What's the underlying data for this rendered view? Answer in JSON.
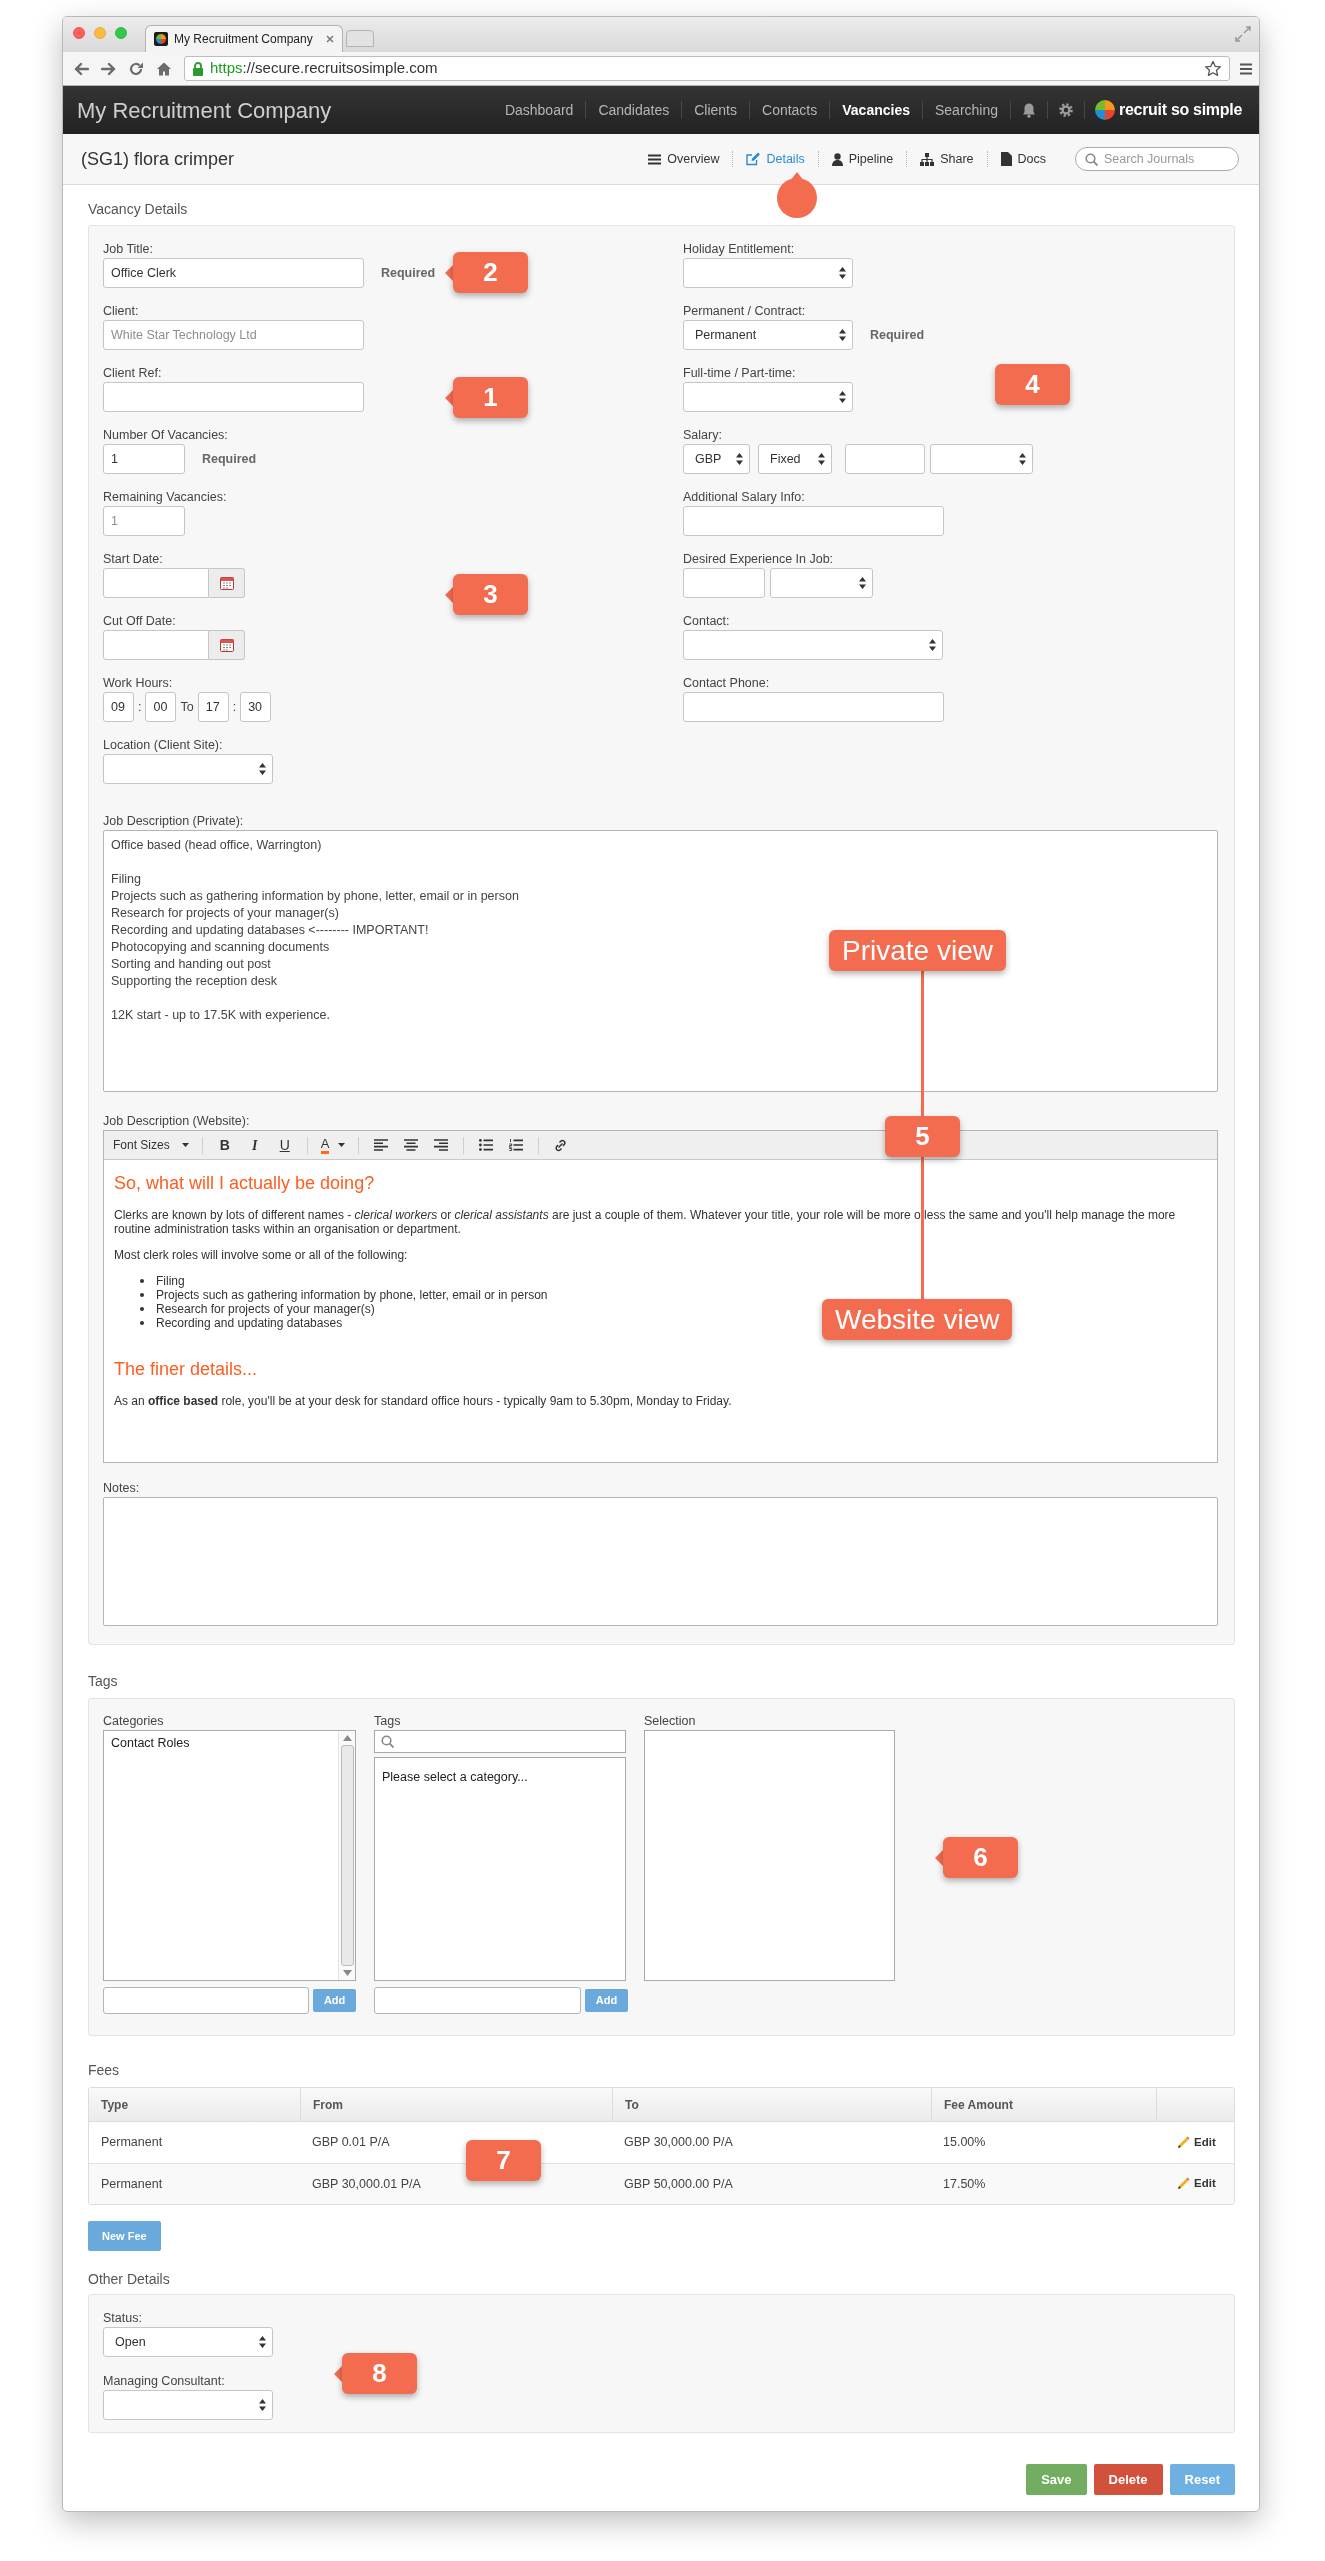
{
  "browser": {
    "tab_title": "My Recruitment Company",
    "url_scheme": "https",
    "url_rest": "://secure.recruitsosimple.com"
  },
  "navbar": {
    "brand": "My Recruitment Company",
    "items": [
      {
        "label": "Dashboard",
        "selected": false
      },
      {
        "label": "Candidates",
        "selected": false
      },
      {
        "label": "Clients",
        "selected": false
      },
      {
        "label": "Contacts",
        "selected": false
      },
      {
        "label": "Vacancies",
        "selected": true
      },
      {
        "label": "Searching",
        "selected": false
      }
    ],
    "logo_text": "recruit so simple"
  },
  "page_header": {
    "title": "(SG1) flora crimper",
    "tabs": [
      {
        "kind": "list",
        "label": "Overview",
        "selected": false
      },
      {
        "kind": "edit",
        "label": "Details",
        "selected": true
      },
      {
        "kind": "user",
        "label": "Pipeline",
        "selected": false
      },
      {
        "kind": "tree",
        "label": "Share",
        "selected": false
      },
      {
        "kind": "file",
        "label": "Docs",
        "selected": false
      }
    ],
    "search": {
      "placeholder": "Search Journals"
    }
  },
  "vacancy_details": {
    "title": "Vacancy Details",
    "left_fields": [
      {
        "kind": "text",
        "label": "Job Title:",
        "value": "Office Clerk",
        "note": "Required"
      },
      {
        "kind": "readonly_text",
        "label": "Client:",
        "value": "White Star Technology Ltd"
      },
      {
        "kind": "text",
        "label": "Client Ref:"
      },
      {
        "kind": "number",
        "label": "Number Of Vacancies:",
        "value": "1",
        "note": "Required"
      },
      {
        "kind": "readonly_number",
        "label": "Remaining Vacancies:",
        "value": "1"
      },
      {
        "kind": "date",
        "label": "Start Date:"
      },
      {
        "kind": "date",
        "label": "Cut Off Date:"
      },
      {
        "kind": "time_range",
        "label": "Work Hours:",
        "parts": [
          {
            "kind": "input",
            "value": "09"
          },
          {
            "kind": "text",
            "text": ":"
          },
          {
            "kind": "input",
            "value": "00"
          },
          {
            "kind": "text",
            "text": "To"
          },
          {
            "kind": "input",
            "value": "17"
          },
          {
            "kind": "text",
            "text": ":"
          },
          {
            "kind": "input",
            "value": "30"
          }
        ]
      },
      {
        "kind": "select",
        "label": "Location (Client Site):"
      }
    ],
    "right_fields": [
      {
        "kind": "select",
        "label": "Holiday Entitlement:"
      },
      {
        "kind": "select",
        "label": "Permanent / Contract:",
        "value": "Permanent",
        "note": "Required"
      },
      {
        "kind": "select",
        "label": "Full-time / Part-time:"
      },
      {
        "kind": "salary",
        "label": "Salary:",
        "currency": "GBP",
        "rate_type": "Fixed"
      },
      {
        "kind": "text",
        "label": "Additional Salary Info:"
      },
      {
        "kind": "experience",
        "label": "Desired Experience In Job:"
      },
      {
        "kind": "select_wide",
        "label": "Contact:"
      },
      {
        "kind": "text",
        "label": "Contact Phone:"
      }
    ],
    "private_description": {
      "label": "Job Description (Private):",
      "value": "Office based (head office, Warrington)\n\nFiling\nProjects such as gathering information by phone, letter, email or in person\nResearch for projects of your manager(s)\nRecording and updating databases <-------- IMPORTANT!\nPhotocopying and scanning documents\nSorting and handing out post\nSupporting the reception desk\n\n12K start - up to 17.5K with experience."
    },
    "website_description": {
      "label": "Job Description (Website):",
      "toolbar": {
        "font_size_menu": "Font Sizes",
        "format_buttons": [
          "B",
          "I",
          "U"
        ],
        "text_color_button": "A"
      },
      "content": [
        {
          "kind": "heading",
          "text": "So, what will I actually be doing?"
        },
        {
          "kind": "paragraph",
          "text": "Clerks are known by lots of different names - *clerical workers* or *clerical assistants* are just a couple of them. Whatever your title, your role will be more o less the same and you'll help manage the more routine administration tasks within an organisation or department."
        },
        {
          "kind": "paragraph",
          "text": "Most clerk roles will involve some or all of the following:"
        },
        {
          "kind": "list",
          "items": [
            "Filing",
            "Projects such as gathering information by phone, letter, email or in person",
            "Research for projects of your manager(s)",
            "Recording and updating databases"
          ]
        },
        {
          "kind": "heading",
          "text": "The finer details..."
        },
        {
          "kind": "paragraph",
          "text": "As an **office based** role, you'll be at your desk for standard office hours - typically 9am to 5.30pm, Monday to Friday."
        }
      ]
    },
    "notes": {
      "label": "Notes:"
    }
  },
  "tags": {
    "title": "Tags",
    "categories": {
      "label": "Categories",
      "options": [
        "Contact Roles"
      ],
      "add_button": "Add"
    },
    "tags": {
      "label": "Tags",
      "message": "Please select a category...",
      "add_button": "Add"
    },
    "selection": {
      "label": "Selection"
    }
  },
  "fees": {
    "title": "Fees",
    "columns": [
      "Type",
      "From",
      "To",
      "Fee Amount"
    ],
    "rows": [
      {
        "type": "Permanent",
        "from": "GBP 0.01 P/A",
        "to": "GBP 30,000.00 P/A",
        "fee_amount": "15.00%",
        "action": "Edit"
      },
      {
        "type": "Permanent",
        "from": "GBP 30,000.01 P/A",
        "to": "GBP 50,000.00 P/A",
        "fee_amount": "17.50%",
        "action": "Edit"
      }
    ],
    "new_button": "New Fee"
  },
  "other_details": {
    "title": "Other Details",
    "fields": [
      {
        "label": "Status:",
        "value": "Open"
      },
      {
        "label": "Managing Consultant:"
      }
    ]
  },
  "actions": [
    {
      "kind": "success",
      "label": "Save"
    },
    {
      "kind": "danger",
      "label": "Delete"
    },
    {
      "kind": "info",
      "label": "Reset"
    }
  ],
  "annotations": [
    {
      "kind": "marker"
    },
    {
      "kind": "badge",
      "text": "2",
      "pointer": true
    },
    {
      "kind": "badge",
      "text": "4",
      "pointer": false
    },
    {
      "kind": "badge",
      "text": "1",
      "pointer": true
    },
    {
      "kind": "badge",
      "text": "3",
      "pointer": true
    },
    {
      "kind": "label",
      "text": "Private view",
      "pointer": false
    },
    {
      "kind": "badge",
      "text": "5",
      "pointer": false
    },
    {
      "kind": "connector"
    },
    {
      "kind": "label",
      "text": "Website view",
      "pointer": false
    },
    {
      "kind": "badge",
      "text": "6",
      "pointer": true
    },
    {
      "kind": "badge",
      "text": "7",
      "pointer": false
    },
    {
      "kind": "badge",
      "text": "8",
      "pointer": true
    }
  ]
}
